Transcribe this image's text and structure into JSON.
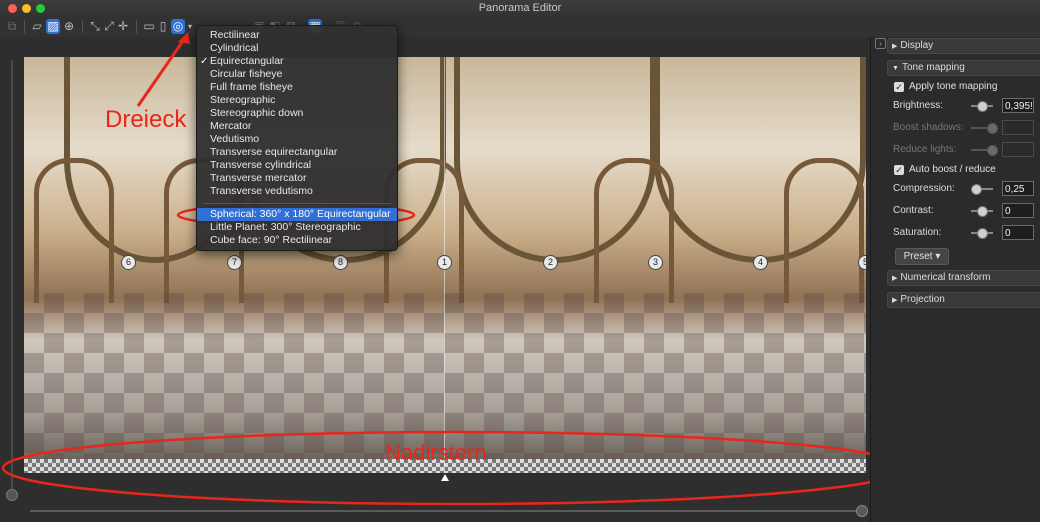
{
  "window": {
    "title": "Panorama Editor"
  },
  "toolbar": {
    "icons": [
      "sidebar-toggle-icon",
      "layers-icon",
      "crop-icon",
      "target-icon",
      "fit-icon",
      "expand-icon",
      "crosshair-icon",
      "rectangle-icon",
      "cylinder-icon",
      "sphere-icon",
      "dropdown-arrow-icon",
      "mask-icon",
      "pin-icon",
      "view-icon",
      "grid-icon",
      "export-icon",
      "settings-icon"
    ]
  },
  "projection_menu": {
    "items": [
      {
        "label": "Rectilinear",
        "checked": false
      },
      {
        "label": "Cylindrical",
        "checked": false
      },
      {
        "label": "Equirectangular",
        "checked": true
      },
      {
        "label": "Circular fisheye",
        "checked": false
      },
      {
        "label": "Full frame fisheye",
        "checked": false
      },
      {
        "label": "Stereographic",
        "checked": false
      },
      {
        "label": "Stereographic down",
        "checked": false
      },
      {
        "label": "Mercator",
        "checked": false
      },
      {
        "label": "Vedutismo",
        "checked": false
      },
      {
        "label": "Transverse equirectangular",
        "checked": false
      },
      {
        "label": "Transverse cylindrical",
        "checked": false
      },
      {
        "label": "Transverse mercator",
        "checked": false
      },
      {
        "label": "Transverse vedutismo",
        "checked": false
      }
    ],
    "presets": [
      {
        "label": "Spherical: 360° x 180° Equirectangular",
        "highlighted": true
      },
      {
        "label": "Little Planet: 300° Stereographic",
        "highlighted": false
      },
      {
        "label": "Cube face: 90° Rectilinear",
        "highlighted": false
      }
    ]
  },
  "control_points": [
    "6",
    "7",
    "8",
    "1",
    "2",
    "3",
    "4",
    "5"
  ],
  "annotations": {
    "dreieck": "Dreieck",
    "nadirstern": "Nadirstern",
    "color": "#e8261a"
  },
  "panel": {
    "sections": {
      "display": "Display",
      "tone_mapping": "Tone mapping",
      "numerical_transform": "Numerical transform",
      "projection": "Projection"
    },
    "tone": {
      "apply_label": "Apply tone mapping",
      "apply_checked": true,
      "brightness_label": "Brightness:",
      "brightness_value": "0,395!",
      "boost_shadows_label": "Boost shadows:",
      "reduce_lights_label": "Reduce lights:",
      "auto_boost_label": "Auto boost / reduce",
      "auto_boost_checked": true,
      "compression_label": "Compression:",
      "compression_value": "0,25",
      "contrast_label": "Contrast:",
      "contrast_value": "0",
      "saturation_label": "Saturation:",
      "saturation_value": "0",
      "preset_label": "Preset ▾"
    }
  },
  "colors": {
    "accent": "#2f6fd6",
    "annotation": "#e8261a"
  }
}
